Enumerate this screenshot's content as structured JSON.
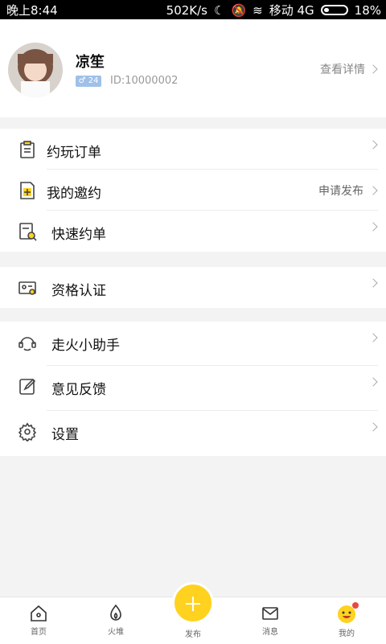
{
  "status": {
    "time": "晚上8:44",
    "speed": "502K/s",
    "carrier": "移动 4G",
    "battery": "18%"
  },
  "profile": {
    "name": "凉笙",
    "gender_badge": "♂ 24",
    "id_text": "ID:10000002",
    "detail_label": "查看详情"
  },
  "menu": {
    "group1": [
      {
        "label": "约玩订单",
        "right": "",
        "icon": "clipboard-icon"
      },
      {
        "label": "我的邀约",
        "right": "申请发布",
        "icon": "invite-add-icon"
      },
      {
        "label": "快速约单",
        "right": "",
        "icon": "search-order-icon"
      }
    ],
    "group2": [
      {
        "label": "资格认证",
        "right": "",
        "icon": "id-card-icon"
      }
    ],
    "group3": [
      {
        "label": "走火小助手",
        "right": "",
        "icon": "assistant-icon"
      },
      {
        "label": "意见反馈",
        "right": "",
        "icon": "feedback-icon"
      },
      {
        "label": "设置",
        "right": "",
        "icon": "settings-icon"
      }
    ]
  },
  "tabs": {
    "home": "首页",
    "fire": "火堆",
    "publish": "发布",
    "messages": "消息",
    "mine": "我的"
  },
  "colors": {
    "accent": "#ffd21f",
    "badge": "#9fc0e8"
  }
}
